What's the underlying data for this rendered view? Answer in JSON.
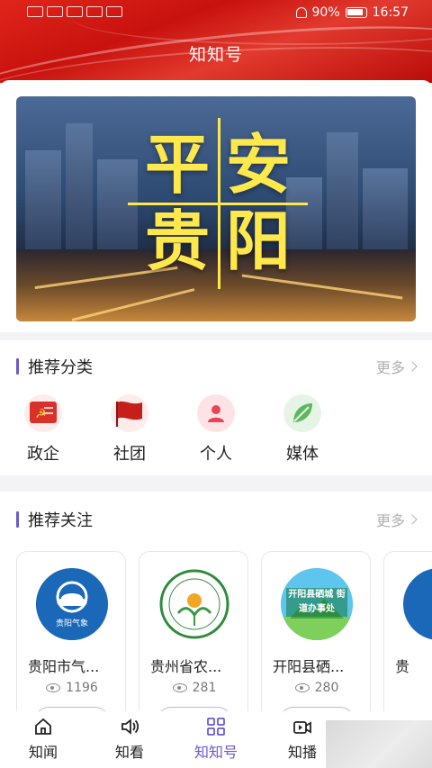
{
  "status_bar": {
    "battery": "90%",
    "time": "16:57"
  },
  "header": {
    "title": "知知号"
  },
  "banner": {
    "chars": [
      "平",
      "安",
      "贵",
      "阳"
    ]
  },
  "categories_section": {
    "title": "推荐分类",
    "more": "更多",
    "items": [
      {
        "label": "政企",
        "icon": "party-flag-icon",
        "color": "#d9302a"
      },
      {
        "label": "社团",
        "icon": "red-flag-icon",
        "color": "#c61f1b"
      },
      {
        "label": "个人",
        "icon": "person-icon",
        "color": "#e8455a"
      },
      {
        "label": "媒体",
        "icon": "leaf-icon",
        "color": "#4caf50"
      }
    ]
  },
  "follow_section": {
    "title": "推荐关注",
    "more": "更多",
    "cards": [
      {
        "name": "贵阳市气...",
        "views": "1196",
        "logo": "weather-logo-icon",
        "logo_text": "贵阳气象"
      },
      {
        "name": "贵州省农...",
        "views": "281",
        "logo": "agri-seal-icon"
      },
      {
        "name": "开阳县硒...",
        "views": "280",
        "logo": "street-office-logo-icon",
        "logo_text": "开阳县硒城 街道办事处"
      },
      {
        "name": "贵",
        "views": "",
        "logo": "partial-logo-icon"
      }
    ]
  },
  "bottom_nav": {
    "items": [
      {
        "label": "知闻",
        "icon": "home-icon",
        "active": false
      },
      {
        "label": "知看",
        "icon": "speaker-icon",
        "active": false
      },
      {
        "label": "知知号",
        "icon": "grid-icon",
        "active": true
      },
      {
        "label": "知播",
        "icon": "video-icon",
        "active": false
      }
    ]
  },
  "colors": {
    "accent": "#6a5acd",
    "header_red": "#d01a14"
  }
}
